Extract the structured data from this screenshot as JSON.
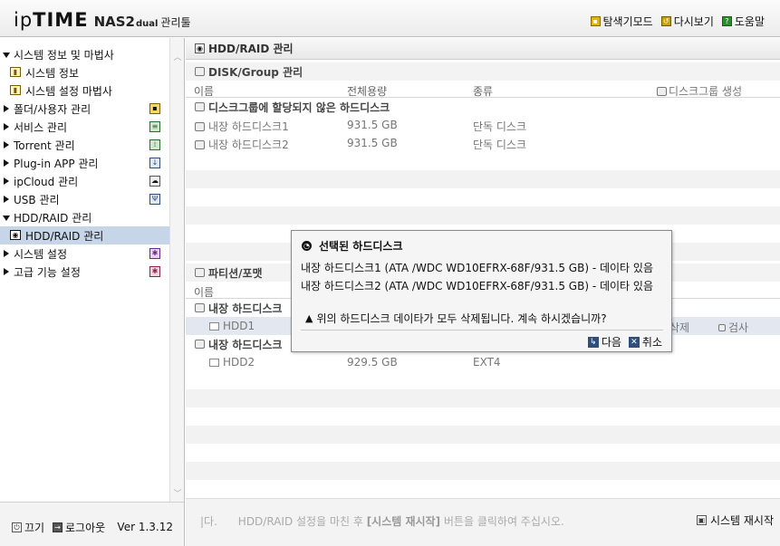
{
  "header": {
    "logo_ip": "ip",
    "logo_time": "TIME",
    "logo_nas": "NAS2",
    "logo_dual": "dual",
    "logo_manage": "관리툴",
    "links": [
      {
        "label": "탐색기모드",
        "icon": "folder-icon"
      },
      {
        "label": "다시보기",
        "icon": "refresh-icon"
      },
      {
        "label": "도움말",
        "icon": "help-icon"
      }
    ]
  },
  "sidebar": {
    "items": [
      {
        "label": "시스템 정보 및 마법사"
      },
      {
        "label": "시스템 정보"
      },
      {
        "label": "시스템 설정 마법사"
      },
      {
        "label": "폴더/사용자 관리"
      },
      {
        "label": "서비스 관리"
      },
      {
        "label": "Torrent 관리"
      },
      {
        "label": "Plug-in APP 관리"
      },
      {
        "label": "ipCloud 관리"
      },
      {
        "label": "USB 관리"
      },
      {
        "label": "HDD/RAID 관리"
      },
      {
        "label": "HDD/RAID 관리"
      },
      {
        "label": "시스템 설정"
      },
      {
        "label": "고급 기능 설정"
      }
    ],
    "footer": {
      "off_label": "끄기",
      "logout_label": "로그아웃",
      "version": "Ver 1.3.12"
    }
  },
  "main": {
    "title": "HDD/RAID 관리",
    "disk_group": {
      "title": "DISK/Group 관리",
      "columns": [
        "이름",
        "전체용량",
        "종류"
      ],
      "create_label": "디스크그룹 생성",
      "unassigned_label": "디스크그룹에 할당되지 않은 하드디스크",
      "rows": [
        {
          "name": "내장 하드디스크1",
          "size": "931.5 GB",
          "type": "단독 디스크"
        },
        {
          "name": "내장 하드디스크2",
          "size": "931.5 GB",
          "type": "단독 디스크"
        }
      ]
    },
    "partition": {
      "title": "파티션/포맷",
      "columns": [
        "이름"
      ],
      "groups": [
        {
          "label": "내장 하드디스크",
          "row": {
            "name": "HDD1",
            "delete": "삭제",
            "check": "검사"
          }
        },
        {
          "label": "내장 하드디스크",
          "row": {
            "name": "HDD2",
            "size": "929.5 GB",
            "fs": "EXT4"
          }
        }
      ]
    },
    "footer": {
      "notice_prefix": "|다.",
      "notice_mid": "HDD/RAID 설정을 마친 후 ",
      "notice_bold": "[시스템 재시작]",
      "notice_suffix": " 버튼을 클릭하여 주십시오.",
      "reboot_label": "시스템 재시작"
    }
  },
  "dialog": {
    "title": "선택된 하드디스크",
    "lines": [
      "내장 하드디스크1 (ATA /WDC WD10EFRX-68F/931.5 GB)  - 데이타 있음",
      "내장 하드디스크2 (ATA /WDC WD10EFRX-68F/931.5 GB)  - 데이타 있음"
    ],
    "warning": "위의 하드디스크 데이타가 모두 삭제됩니다. 계속 하시겠습니까?",
    "next_label": "다음",
    "cancel_label": "취소"
  },
  "colors": {
    "selected_bg": "#c7d5e8",
    "button_icon": "#2f4f7a"
  }
}
